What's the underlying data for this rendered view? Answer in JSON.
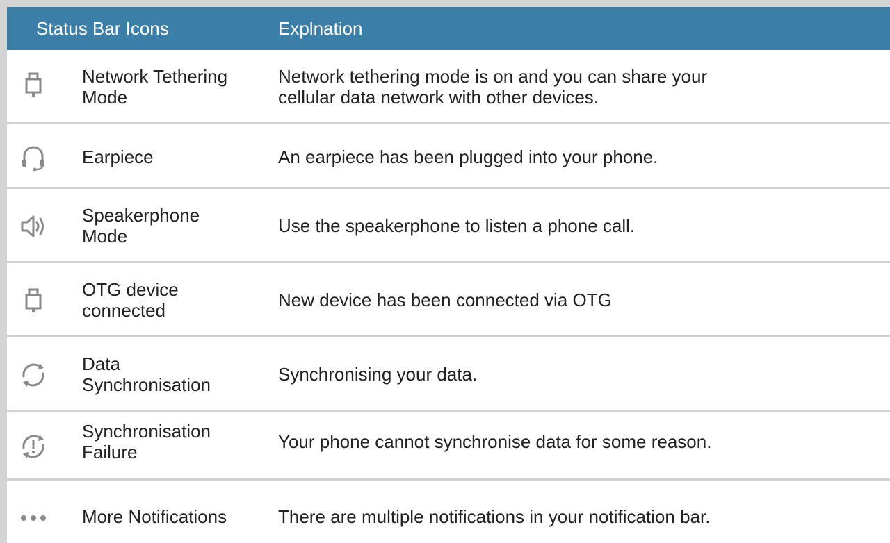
{
  "header": {
    "col_icons": "Status Bar Icons",
    "col_explanation": "Explnation"
  },
  "rows": [
    {
      "icon": "usb-plug-icon",
      "name_lines": [
        "Network Tethering",
        "Mode"
      ],
      "desc_lines": [
        "Network tethering mode is on and you can share your",
        "cellular data network with other devices."
      ]
    },
    {
      "icon": "headset-icon",
      "name_lines": [
        "Earpiece"
      ],
      "desc_lines": [
        "An earpiece has been plugged into your phone."
      ]
    },
    {
      "icon": "speaker-icon",
      "name_lines": [
        "Speakerphone",
        "Mode"
      ],
      "desc_lines": [
        "Use the speakerphone to listen a phone call."
      ]
    },
    {
      "icon": "usb-plug-icon",
      "name_lines": [
        "OTG device",
        "connected"
      ],
      "desc_lines": [
        "New device has been connected via OTG"
      ]
    },
    {
      "icon": "sync-icon",
      "name_lines": [
        "Data",
        "Synchronisation"
      ],
      "desc_lines": [
        "Synchronising your data."
      ]
    },
    {
      "icon": "sync-failure-icon",
      "name_lines": [
        "Synchronisation",
        "Failure"
      ],
      "desc_lines": [
        "Your phone cannot synchronise data for some reason."
      ]
    },
    {
      "icon": "more-dots-icon",
      "name_lines": [
        "More Notifications"
      ],
      "desc_lines": [
        "There are multiple notifications in your notification bar."
      ]
    }
  ],
  "colors": {
    "header_bg": "#3b7fa9",
    "header_text": "#ffffff",
    "body_text": "#222222",
    "divider": "#d2d2d2",
    "icon": "#8a8a8a"
  }
}
